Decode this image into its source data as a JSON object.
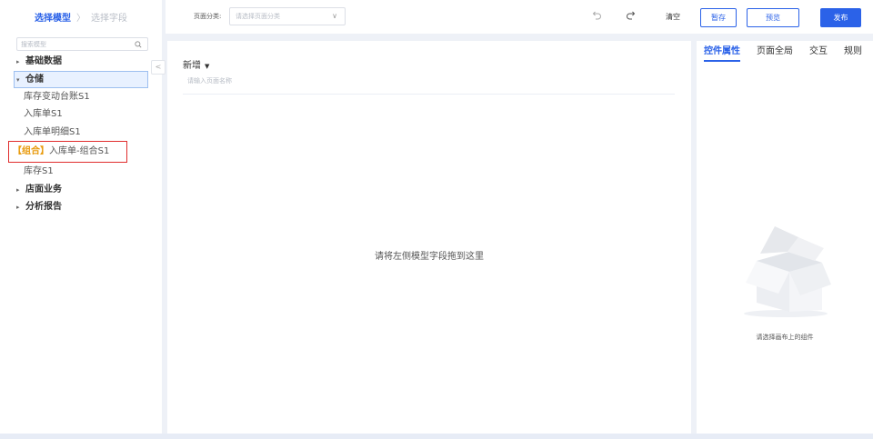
{
  "steps": {
    "active": "选择模型",
    "separator": "〉",
    "inactive": "选择字段"
  },
  "search": {
    "placeholder": "搜索模型"
  },
  "tree": {
    "base": "基础数据",
    "warehouse": "仓储",
    "leaf1": "库存变动台账S1",
    "leaf2": "入库单S1",
    "leaf3": "入库单明细S1",
    "combo_tag": "【组合】",
    "combo_label": "入库单-组合S1",
    "leaf4": "库存S1",
    "store": "店面业务",
    "report": "分析报告"
  },
  "collapse_glyph": "<",
  "topbar": {
    "category_label": "页面分类:",
    "category_placeholder": "请选择页面分类",
    "clear": "清空",
    "save": "暂存",
    "preview": "预览",
    "publish": "发布"
  },
  "canvas": {
    "title": "新增",
    "name_placeholder": "请输入页面名称",
    "drop_hint": "请将左侧模型字段拖到这里"
  },
  "right": {
    "tabs": [
      "控件属性",
      "页面全局",
      "交互",
      "规则"
    ],
    "empty_text": "请选择画布上的组件"
  },
  "colors": {
    "primary": "#2b62e8",
    "highlight": "#e02d2d",
    "combo": "#e89a0c"
  }
}
